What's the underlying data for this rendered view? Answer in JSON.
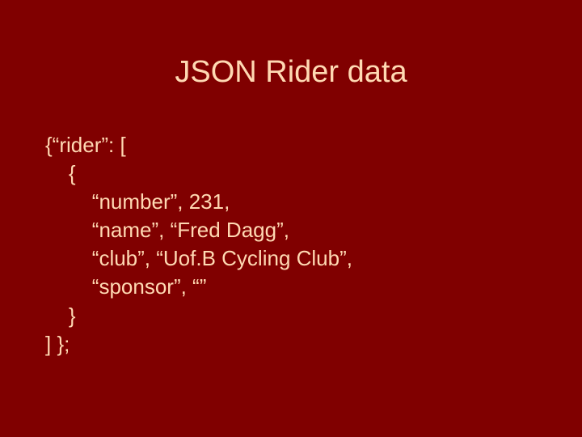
{
  "title": "JSON Rider data",
  "code": {
    "l1": "{“rider”: [",
    "l2": "    {",
    "l3": "        “number”, 231,",
    "l4": "        “name”, “Fred Dagg”,",
    "l5": "        “club”, “Uof.B Cycling Club”,",
    "l6": "        “sponsor”, “”",
    "l7": "    }",
    "l8": "] };"
  }
}
